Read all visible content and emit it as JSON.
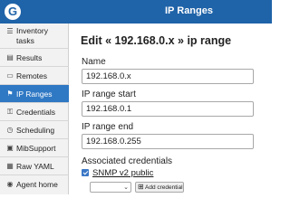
{
  "header": {
    "logo_letter": "G",
    "title": "IP Ranges"
  },
  "sidebar": {
    "items": [
      {
        "label_line1": "Inventory",
        "label_line2": "tasks",
        "icon": "tasks-icon",
        "active": false
      },
      {
        "label_line1": "Results",
        "label_line2": "",
        "icon": "results-icon",
        "active": false
      },
      {
        "label_line1": "Remotes",
        "label_line2": "",
        "icon": "remotes-icon",
        "active": false
      },
      {
        "label_line1": "IP Ranges",
        "label_line2": "",
        "icon": "ip-ranges-icon",
        "active": true
      },
      {
        "label_line1": "Credentials",
        "label_line2": "",
        "icon": "credentials-icon",
        "active": false
      },
      {
        "label_line1": "Scheduling",
        "label_line2": "",
        "icon": "scheduling-icon",
        "active": false
      },
      {
        "label_line1": "MibSupport",
        "label_line2": "",
        "icon": "mibsupport-icon",
        "active": false
      },
      {
        "label_line1": "Raw YAML",
        "label_line2": "",
        "icon": "raw-yaml-icon",
        "active": false
      },
      {
        "label_line1": "Agent home",
        "label_line2": "",
        "icon": "agent-home-icon",
        "active": false
      }
    ]
  },
  "main": {
    "title": "Edit « 192.168.0.x » ip range",
    "name_label": "Name",
    "name_value": "192.168.0.x",
    "start_label": "IP range start",
    "start_value": "192.168.0.1",
    "end_label": "IP range end",
    "end_value": "192.168.0.255",
    "credentials_label": "Associated credentials",
    "credential_item": "SNMP v2 public",
    "credential_checked": true,
    "select_value": "",
    "add_button": "Add credential"
  },
  "colors": {
    "header_bg": "#1f63a8",
    "active_nav_bg": "#2f78c4"
  }
}
